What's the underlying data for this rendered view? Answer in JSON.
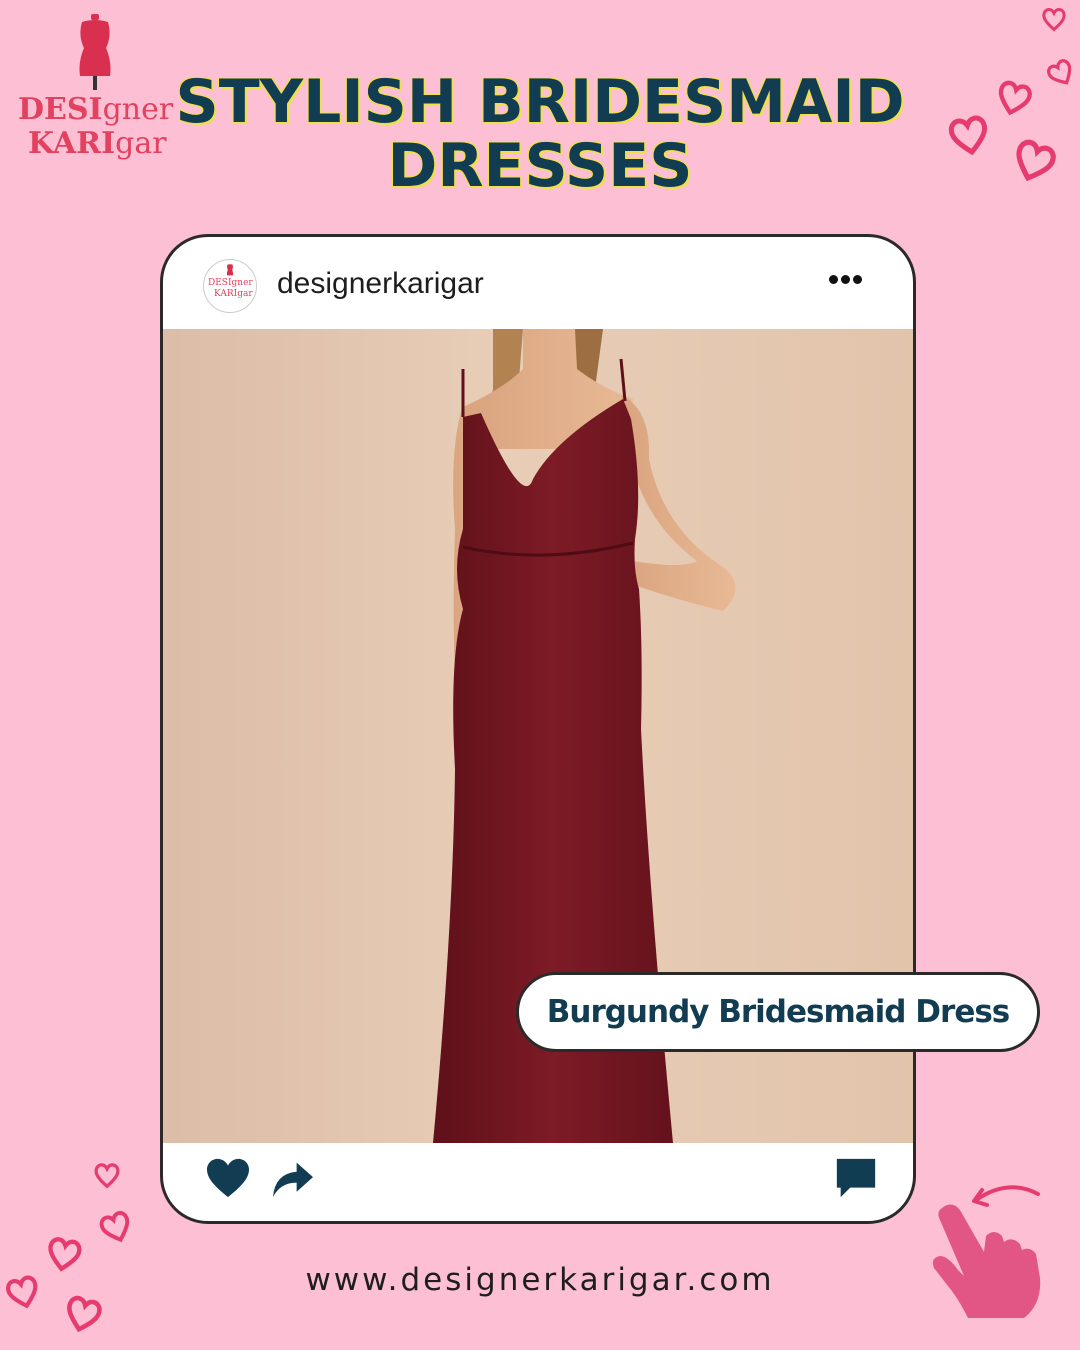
{
  "brand": {
    "logo_line1_bold": "DESI",
    "logo_line1_rest": "gner",
    "logo_line2_bold": "KARI",
    "logo_line2_rest": "gar"
  },
  "headline": "STYLISH BRIDESMAID DRESSES",
  "post": {
    "username": "designerkarigar",
    "avatar_line1": "DESIgner",
    "avatar_line2": "KARIgar",
    "image_subject": "Model wearing a long burgundy spaghetti-strap bridesmaid gown against a beige backdrop",
    "label": "Burgundy Bridesmaid Dress",
    "actions": [
      "heart-icon",
      "share-icon",
      "comment-icon"
    ]
  },
  "footer": {
    "website": "www.designerkarigar.com"
  },
  "colors": {
    "background": "#fdbfd3",
    "headline": "#123c52",
    "headline_outline": "#f0e048",
    "accent_pink": "#e63b6f",
    "icon": "#123c52",
    "dress": "#7a1a24"
  }
}
